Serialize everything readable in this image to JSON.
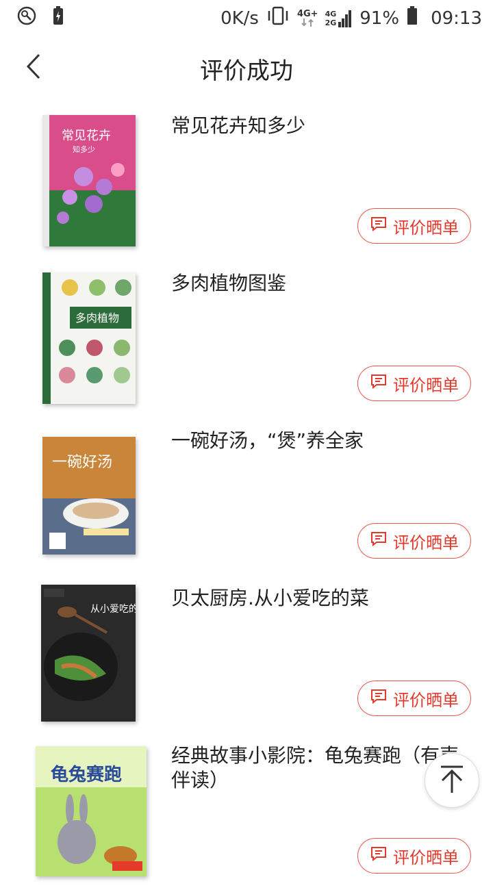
{
  "status_bar": {
    "speed": "0K/s",
    "net1": "4G+",
    "net2a": "4G",
    "net2b": "2G",
    "battery": "91%",
    "time": "09:13"
  },
  "header": {
    "title": "评价成功"
  },
  "items": [
    {
      "title": "常见花卉知多少",
      "button_label": "评价晒单",
      "cover_text": "常见花卉",
      "cover_sub": "知多少"
    },
    {
      "title": "多肉植物图鉴",
      "button_label": "评价晒单",
      "cover_text": "多肉植物"
    },
    {
      "title": "一碗好汤，“煲”养全家",
      "button_label": "评价晒单",
      "cover_text": "一碗好汤"
    },
    {
      "title": "贝太厨房.从小爱吃的菜",
      "button_label": "评价晒单",
      "cover_text": "从小爱吃的菜"
    },
    {
      "title": "经典故事小影院：龟兔赛跑（有声伴读）",
      "button_label": "评价晒单",
      "cover_text": "龟兔赛跑"
    }
  ],
  "colors": {
    "accent": "#e3382c"
  }
}
